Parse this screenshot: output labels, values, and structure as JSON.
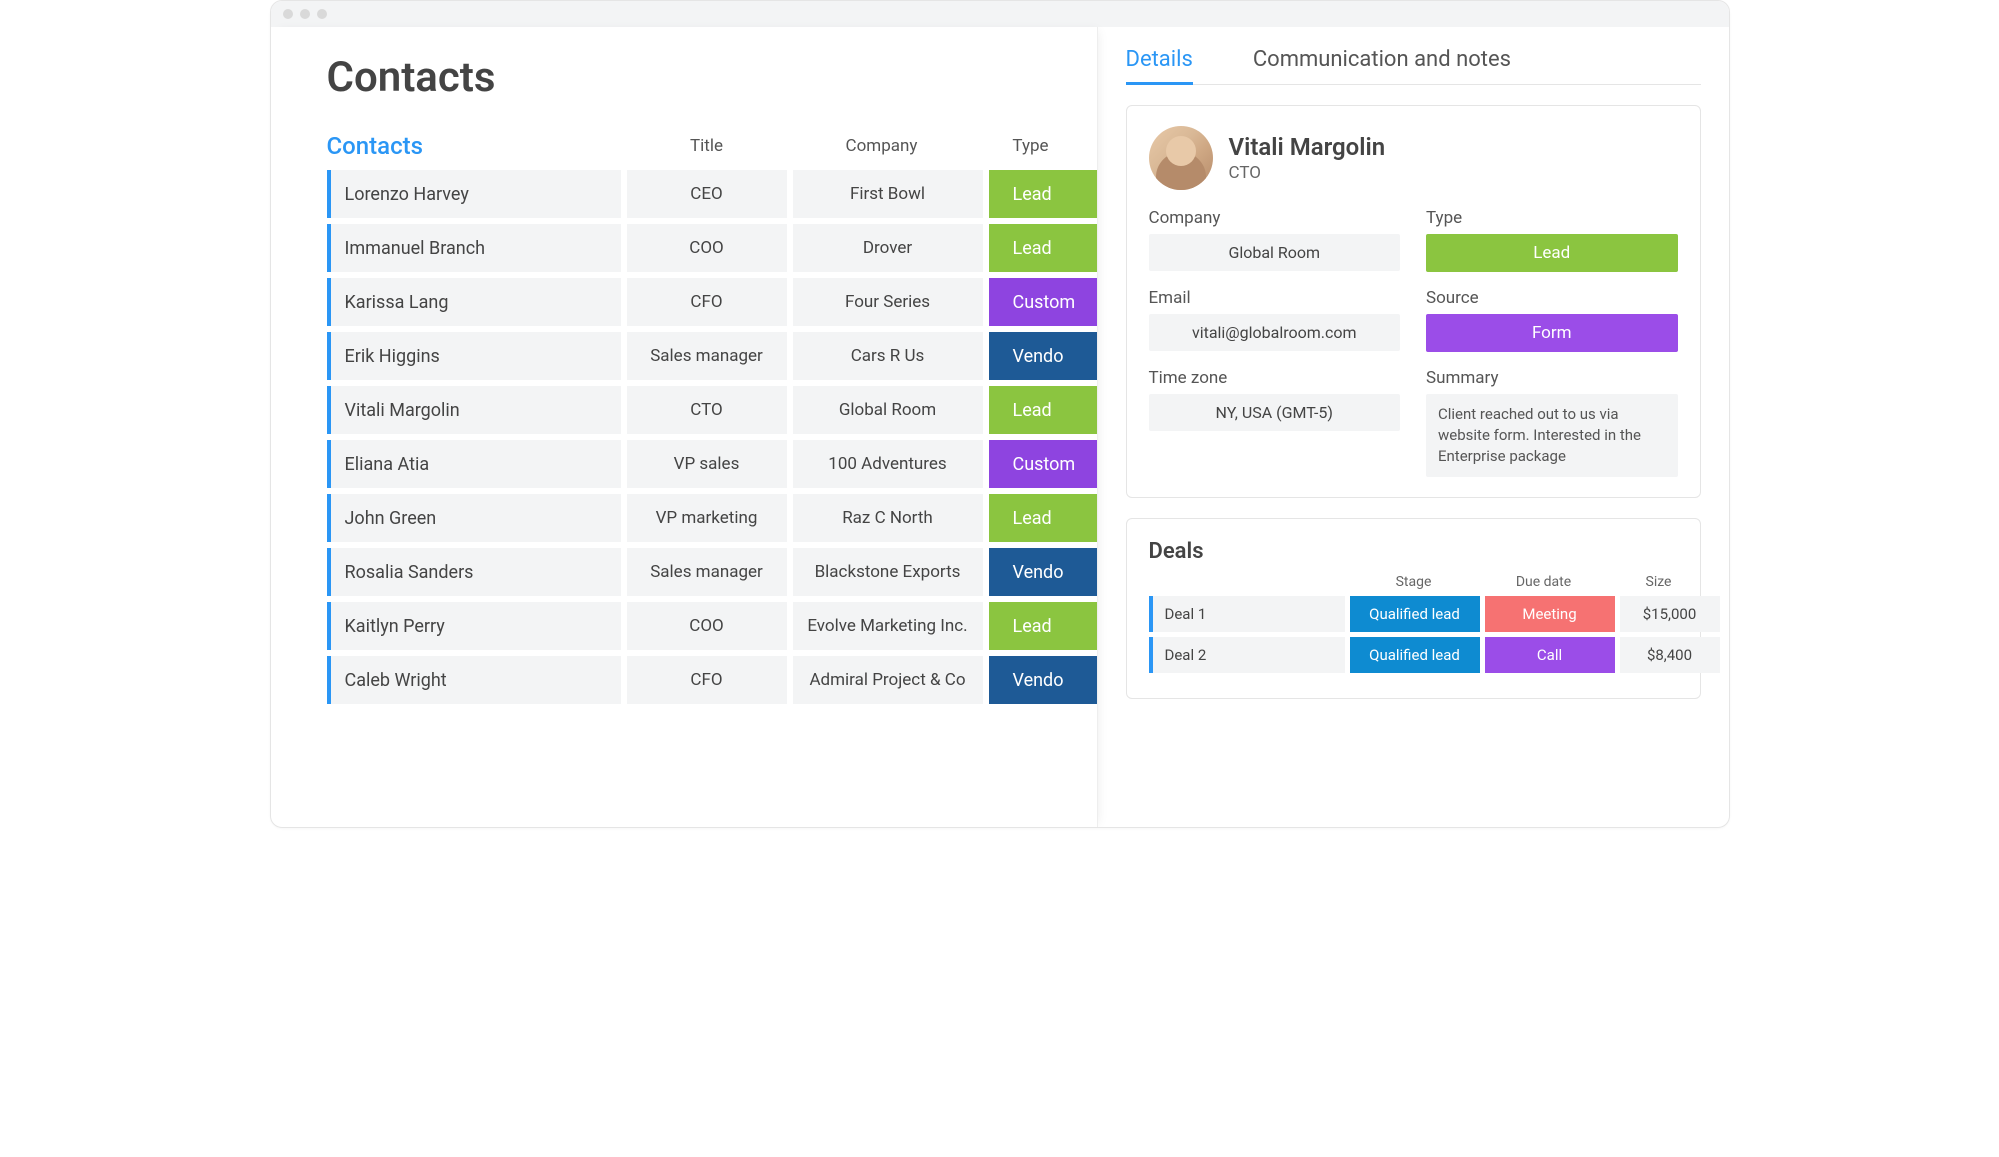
{
  "page": {
    "title": "Contacts",
    "section_label": "Contacts",
    "columns": {
      "title": "Title",
      "company": "Company",
      "type": "Type"
    }
  },
  "type_colors": {
    "Lead": "tag-lead",
    "Customer": "tag-customer",
    "Vendor": "tag-vendor"
  },
  "contacts": [
    {
      "name": "Lorenzo Harvey",
      "title": "CEO",
      "company": "First Bowl",
      "type": "Lead",
      "type_display": "Lead"
    },
    {
      "name": "Immanuel Branch",
      "title": "COO",
      "company": "Drover",
      "type": "Lead",
      "type_display": "Lead"
    },
    {
      "name": "Karissa Lang",
      "title": "CFO",
      "company": "Four Series",
      "type": "Customer",
      "type_display": "Custom"
    },
    {
      "name": "Erik Higgins",
      "title": "Sales manager",
      "company": "Cars R Us",
      "type": "Vendor",
      "type_display": "Vendo"
    },
    {
      "name": "Vitali Margolin",
      "title": "CTO",
      "company": "Global Room",
      "type": "Lead",
      "type_display": "Lead"
    },
    {
      "name": "Eliana Atia",
      "title": "VP sales",
      "company": "100 Adventures",
      "type": "Customer",
      "type_display": "Custom"
    },
    {
      "name": "John Green",
      "title": "VP marketing",
      "company": "Raz C North",
      "type": "Lead",
      "type_display": "Lead"
    },
    {
      "name": "Rosalia Sanders",
      "title": "Sales manager",
      "company": "Blackstone Exports",
      "type": "Vendor",
      "type_display": "Vendo"
    },
    {
      "name": "Kaitlyn Perry",
      "title": "COO",
      "company": "Evolve Marketing Inc.",
      "type": "Lead",
      "type_display": "Lead"
    },
    {
      "name": "Caleb Wright",
      "title": "CFO",
      "company": "Admiral Project & Co",
      "type": "Vendor",
      "type_display": "Vendo"
    }
  ],
  "detail": {
    "tabs": {
      "details": "Details",
      "comm": "Communication and notes"
    },
    "name": "Vitali Margolin",
    "role": "CTO",
    "labels": {
      "company": "Company",
      "type": "Type",
      "email": "Email",
      "source": "Source",
      "tz": "Time zone",
      "summary": "Summary"
    },
    "company": "Global Room",
    "type": "Lead",
    "email": "vitali@globalroom.com",
    "source": "Form",
    "tz": "NY, USA (GMT-5)",
    "summary": "Client reached out to us via website form. Interested in the Enterprise package"
  },
  "deals": {
    "title": "Deals",
    "columns": {
      "stage": "Stage",
      "due": "Due date",
      "size": "Size"
    },
    "rows": [
      {
        "name": "Deal 1",
        "stage": "Qualified lead",
        "due": "Meeting",
        "due_class": "due-meeting",
        "size": "$15,000"
      },
      {
        "name": "Deal 2",
        "stage": "Qualified lead",
        "due": "Call",
        "due_class": "due-call",
        "size": "$8,400"
      }
    ]
  }
}
